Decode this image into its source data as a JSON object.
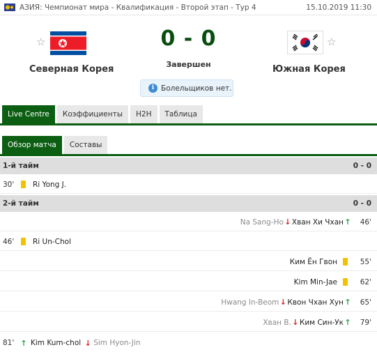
{
  "header": {
    "competition": "АЗИЯ: Чемпионат мира - Квалификация - Второй этап - Тур 4",
    "datetime": "15.10.2019 11:30"
  },
  "match": {
    "home_team": "Северная Корея",
    "away_team": "Южная Корея",
    "score": "0 - 0",
    "status": "Завершен",
    "fans_note": "Болельщиков нет."
  },
  "tabs": [
    "Live Centre",
    "Коэффициенты",
    "H2H",
    "Таблица"
  ],
  "subtabs": [
    "Обзор матча",
    "Составы"
  ],
  "sections": [
    {
      "title": "1-й тайм",
      "score": "0 - 0"
    },
    {
      "title": "2-й тайм",
      "score": "0 - 0"
    }
  ],
  "events": [
    {
      "minute": "30'",
      "player": "Ri Yong J.",
      "type": "yellow-card",
      "side": "home"
    },
    {
      "minute": "46'",
      "player_in": "Хван Хи Чхан",
      "player_out": "Na Sang-Ho",
      "type": "substitution",
      "side": "away"
    },
    {
      "minute": "46'",
      "player": "Ri Un-Chol",
      "type": "yellow-card",
      "side": "home"
    },
    {
      "minute": "55'",
      "player": "Ким Ён Гвон",
      "type": "yellow-card",
      "side": "away"
    },
    {
      "minute": "62'",
      "player": "Kim Min-Jae",
      "type": "yellow-card",
      "side": "away"
    },
    {
      "minute": "65'",
      "player_in": "Квон Чхан Хун",
      "player_out": "Hwang In-Beom",
      "type": "substitution",
      "side": "away"
    },
    {
      "minute": "79'",
      "player_in": "Ким Син-Ук",
      "player_out": "Хван В.",
      "type": "substitution",
      "side": "away"
    },
    {
      "minute": "81'",
      "player_in": "Kim Kum-chol",
      "player_out": "Sim Hyon-Jin",
      "type": "substitution",
      "side": "home"
    }
  ],
  "icons": {
    "competition": "trophy-icon",
    "favorite": "star-outline-icon",
    "info": "info-icon",
    "yellow_card": "yellow-card-icon",
    "sub_in": "arrow-up-icon",
    "sub_out": "arrow-down-icon"
  },
  "colors": {
    "accent_green": "#0b5e12",
    "score_green": "#0b4d10",
    "yellow_card": "#f2c200",
    "arrow_in": "#2da24a",
    "arrow_out": "#dd2222"
  }
}
